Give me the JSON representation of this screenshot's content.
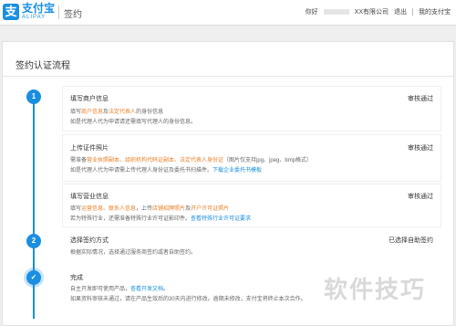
{
  "header": {
    "logo_glyph": "支",
    "logo_name": "支付宝",
    "logo_sub": "ALIPAY",
    "title": "签约",
    "greeting": "你好",
    "company": "XX有限公司",
    "logout": "退出",
    "my_alipay": "我的支付宝"
  },
  "page": {
    "title": "签约认证流程"
  },
  "timeline": {
    "step1": "1",
    "step2": "2",
    "step3": "✓"
  },
  "steps": {
    "s1": {
      "title": "填写商户信息",
      "status": "审核通过",
      "l1a": "填写",
      "l1b": "商户信息",
      "l1c": "及",
      "l1d": "法定代表人",
      "l1e": "的身份信息",
      "l2": "如是代理人代为申请请还需填写代理人的身份信息。"
    },
    "s2": {
      "title": "上传证件照片",
      "status": "审核通过",
      "l1a": "需准备",
      "l1b": "营业执照副本、组织机构代码证副本、法定代表人身份证",
      "l1c": "（图片仅支持jpg、jpeg、bmp格式）",
      "l2a": "如是代理人代为申请需上传代理人身份证及委托书扫描件。",
      "l2b": "下载企业委托书模板"
    },
    "s3": {
      "title": "填写营业信息",
      "status": "审核通过",
      "l1a": "填写",
      "l1b": "运营信息、联系人信息",
      "l1c": "，上传",
      "l1d": "店铺招牌照片",
      "l1e": "及",
      "l1f": "开户许可证照片",
      "l2a": "若为特殊行业，还需准备特殊行业许可证影印件。",
      "l2b": "查看特殊行业许可证要求"
    },
    "s4": {
      "title": "选择签约方式",
      "status": "已选择自助签约",
      "l1": "根据实际情况，选择通过服务商签约或者自助签约。"
    },
    "s5": {
      "title": "完成",
      "l1a": "自主开发即可使用产品，",
      "l1b": "查看开发文档",
      "l1c": "。",
      "l2": "如果资料审核未通过，请在产品生效后的30天内进行修改。逾期未修改，支付宝将终止本次合作。"
    }
  },
  "watermark": "软件技巧"
}
